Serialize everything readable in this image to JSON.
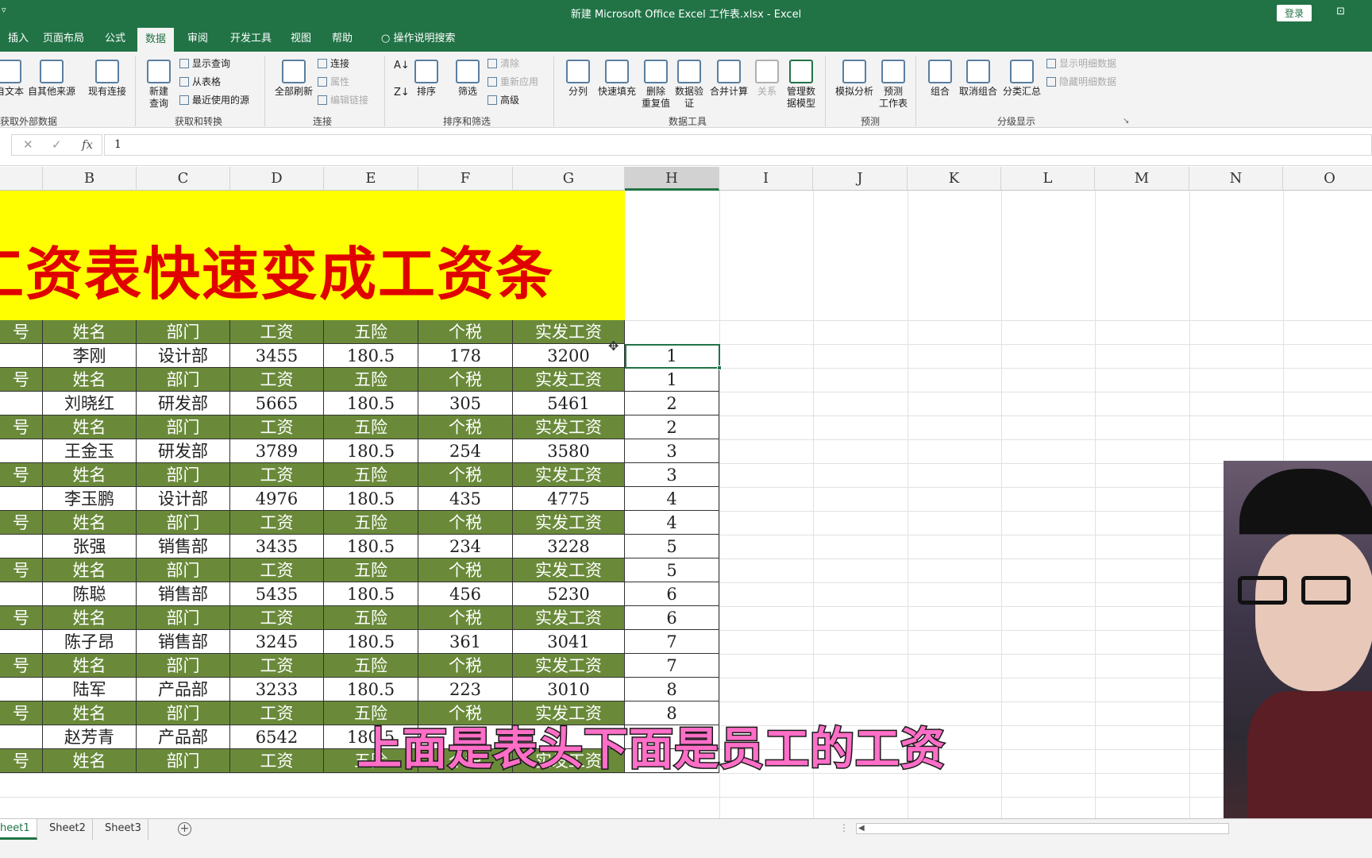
{
  "window": {
    "title": "新建 Microsoft Office Excel 工作表.xlsx  -  Excel",
    "login_label": "登录",
    "qa_glyph": "▿",
    "ribbon_options_glyph": "⊡"
  },
  "tabs": [
    {
      "label": "插入"
    },
    {
      "label": "页面布局"
    },
    {
      "label": "公式"
    },
    {
      "label": "数据",
      "active": true
    },
    {
      "label": "审阅"
    },
    {
      "label": "开发工具"
    },
    {
      "label": "视图"
    },
    {
      "label": "帮助"
    },
    {
      "label": "操作说明搜索"
    }
  ],
  "ribbon": {
    "external": {
      "from_text": "自文本",
      "from_other": "自其他来源",
      "existing_conn": "现有连接",
      "group_label": "获取外部数据"
    },
    "transform": {
      "new_query": "新建\n查询",
      "show_queries": "显示查询",
      "from_table": "从表格",
      "recent_sources": "最近使用的源",
      "group_label": "获取和转换"
    },
    "connections": {
      "refresh_all": "全部刷新",
      "connections": "连接",
      "properties": "属性",
      "edit_links": "编辑链接",
      "group_label": "连接"
    },
    "sort_filter": {
      "sort": "排序",
      "filter": "筛选",
      "clear": "清除",
      "reapply": "重新应用",
      "advanced": "高级",
      "group_label": "排序和筛选"
    },
    "data_tools": {
      "text_to_columns": "分列",
      "flash_fill": "快速填充",
      "remove_dup": "删除\n重复值",
      "validation": "数据验\n证",
      "consolidate": "合并计算",
      "relationships": "关系",
      "data_model": "管理数\n据模型",
      "group_label": "数据工具"
    },
    "forecast": {
      "what_if": "模拟分析",
      "forecast_sheet": "预测\n工作表",
      "group_label": "预测"
    },
    "outline": {
      "group": "组合",
      "ungroup": "取消组合",
      "subtotal": "分类汇总",
      "show_detail": "显示明细数据",
      "hide_detail": "隐藏明细数据",
      "group_label": "分级显示"
    }
  },
  "formula_bar": {
    "value": "1",
    "cancel": "✕",
    "enter": "✓",
    "fx": "fx"
  },
  "columns": [
    "",
    "B",
    "C",
    "D",
    "E",
    "F",
    "G",
    "H",
    "I",
    "J",
    "K",
    "L",
    "M",
    "N",
    "O"
  ],
  "sheet": {
    "title": "工资表快速变成工资条",
    "header_row": [
      "号",
      "姓名",
      "部门",
      "工资",
      "五险",
      "个税",
      "实发工资"
    ],
    "records": [
      {
        "name": "李刚",
        "dept": "设计部",
        "salary": "3455",
        "insurance": "180.5",
        "tax": "178",
        "net": "3200",
        "h1": "1",
        "h2": "1"
      },
      {
        "name": "刘晓红",
        "dept": "研发部",
        "salary": "5665",
        "insurance": "180.5",
        "tax": "305",
        "net": "5461",
        "h1": "2",
        "h2": "2"
      },
      {
        "name": "王金玉",
        "dept": "研发部",
        "salary": "3789",
        "insurance": "180.5",
        "tax": "254",
        "net": "3580",
        "h1": "3",
        "h2": "3"
      },
      {
        "name": "李玉鹏",
        "dept": "设计部",
        "salary": "4976",
        "insurance": "180.5",
        "tax": "435",
        "net": "4775",
        "h1": "4",
        "h2": "4"
      },
      {
        "name": "张强",
        "dept": "销售部",
        "salary": "3435",
        "insurance": "180.5",
        "tax": "234",
        "net": "3228",
        "h1": "5",
        "h2": "5"
      },
      {
        "name": "陈聪",
        "dept": "销售部",
        "salary": "5435",
        "insurance": "180.5",
        "tax": "456",
        "net": "5230",
        "h1": "6",
        "h2": "6"
      },
      {
        "name": "陈子昂",
        "dept": "销售部",
        "salary": "3245",
        "insurance": "180.5",
        "tax": "361",
        "net": "3041",
        "h1": "7",
        "h2": "7"
      },
      {
        "name": "陆军",
        "dept": "产品部",
        "salary": "3233",
        "insurance": "180.5",
        "tax": "223",
        "net": "3010",
        "h1": "8",
        "h2": "8"
      },
      {
        "name": "赵芳青",
        "dept": "产品部",
        "salary": "6542",
        "insurance": "180.5",
        "tax": "",
        "net": "",
        "h1": "",
        "h2": ""
      }
    ]
  },
  "sheet_tabs": [
    {
      "label": "heet1",
      "active": true
    },
    {
      "label": "Sheet2"
    },
    {
      "label": "Sheet3"
    }
  ],
  "add_sheet_glyph": "+",
  "subtitle": "上面是表头下面是员工的工资",
  "colors": {
    "excel_green": "#217346",
    "header_fill": "#6a8a3a",
    "title_fill": "#ffff00",
    "title_text": "#e00000",
    "subtitle": "#ff6ec7"
  }
}
